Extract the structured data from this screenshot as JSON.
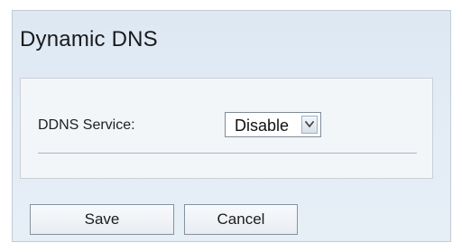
{
  "page": {
    "title": "Dynamic DNS"
  },
  "form": {
    "ddns_service_label": "DDNS Service:",
    "ddns_service_value": "Disable"
  },
  "actions": {
    "save_label": "Save",
    "cancel_label": "Cancel"
  },
  "icons": {
    "dropdown": "chevron-down-icon"
  },
  "colors": {
    "background": "#e3ecf5",
    "panel": "#f3f6f9",
    "border": "#c9d0d7"
  }
}
